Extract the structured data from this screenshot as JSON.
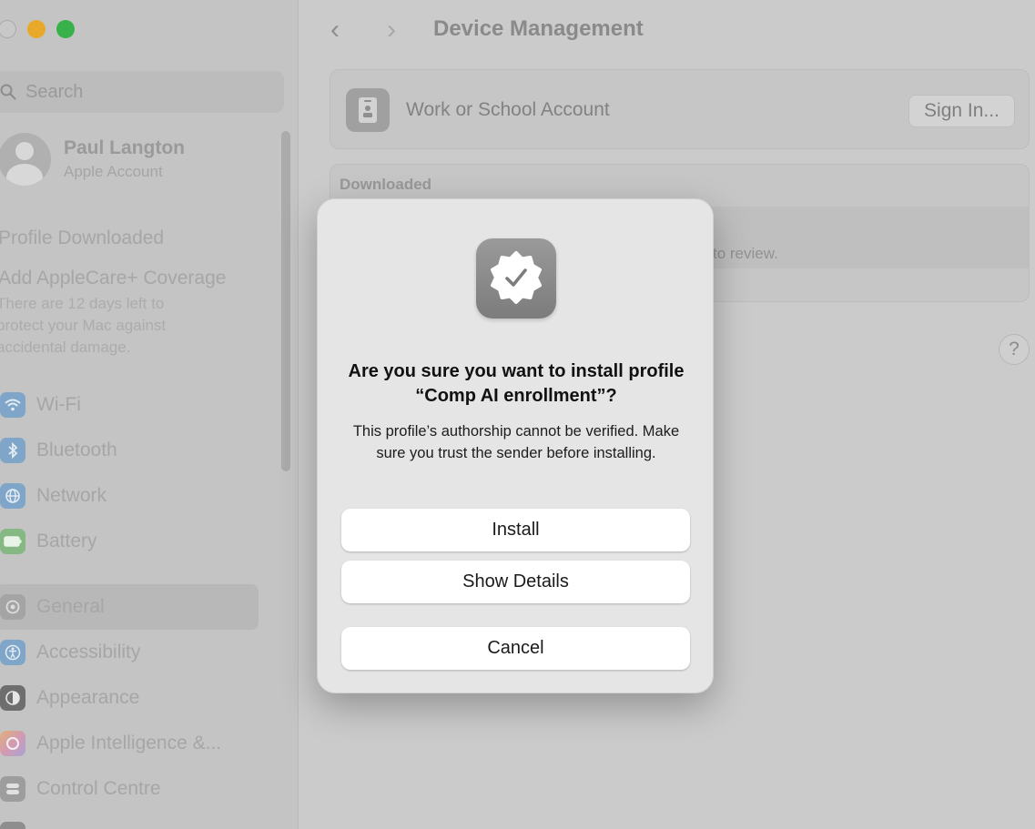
{
  "sidebar": {
    "search_placeholder": "Search",
    "account": {
      "name": "Paul Langton",
      "subtitle": "Apple Account"
    },
    "notices": {
      "profile_downloaded": "Profile Downloaded",
      "applecare_title": "Add AppleCare+ Coverage",
      "applecare_body": "There are 12 days left to protect your Mac against accidental damage."
    },
    "items": [
      {
        "label": "Wi-Fi",
        "icon": "wifi-icon",
        "color": "#7fa6c9"
      },
      {
        "label": "Bluetooth",
        "icon": "bluetooth-icon",
        "color": "#7fa6c9"
      },
      {
        "label": "Network",
        "icon": "globe-icon",
        "color": "#7fa6c9"
      },
      {
        "label": "Battery",
        "icon": "battery-icon",
        "color": "#86b884"
      },
      {
        "label": "General",
        "icon": "gear-icon",
        "color": "#a4a4a4",
        "selected": true
      },
      {
        "label": "Accessibility",
        "icon": "accessibility-icon",
        "color": "#7fa6c9"
      },
      {
        "label": "Appearance",
        "icon": "appearance-icon",
        "color": "#6e6e6e"
      },
      {
        "label": "Apple Intelligence &...",
        "icon": "apple-intelligence-icon",
        "color": "#d39ab0"
      },
      {
        "label": "Control Centre",
        "icon": "control-centre-icon",
        "color": "#9d9d9d"
      }
    ]
  },
  "toolbar": {
    "title": "Device Management",
    "back": "‹",
    "forward": "›"
  },
  "work_account": {
    "label": "Work or School Account",
    "button": "Sign In..."
  },
  "downloaded": {
    "header": "Downloaded",
    "row_text": "to review."
  },
  "help": "?",
  "dialog": {
    "title": "Are you sure you want to install profile “Comp AI enrollment”?",
    "body": "This profile’s authorship cannot be verified. Make sure you trust the sender before installing.",
    "buttons": {
      "install": "Install",
      "details": "Show Details",
      "cancel": "Cancel"
    }
  }
}
